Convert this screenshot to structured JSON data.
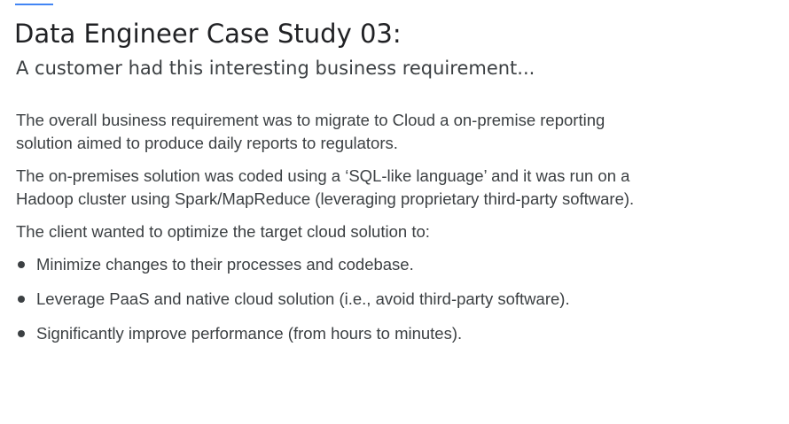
{
  "slide": {
    "title": "Data Engineer Case Study 03:",
    "subtitle": "A customer had this interesting business requirement...",
    "paragraphs": [
      "The overall business requirement was to migrate to Cloud a on-premise reporting solution aimed to produce daily reports to regulators.",
      "The on-premises solution was coded using a ‘SQL-like language’ and it was run on a Hadoop cluster using Spark/MapReduce (leveraging proprietary third-party software).",
      "The client wanted to optimize the target cloud solution to:"
    ],
    "bullets": [
      "Minimize changes to their processes and codebase.",
      "Leverage PaaS and native cloud solution (i.e., avoid third-party software).",
      "Significantly improve performance (from hours to minutes)."
    ]
  },
  "colors": {
    "accent": "#4285f4",
    "title_text": "#202124",
    "body_text": "#3c4043"
  }
}
